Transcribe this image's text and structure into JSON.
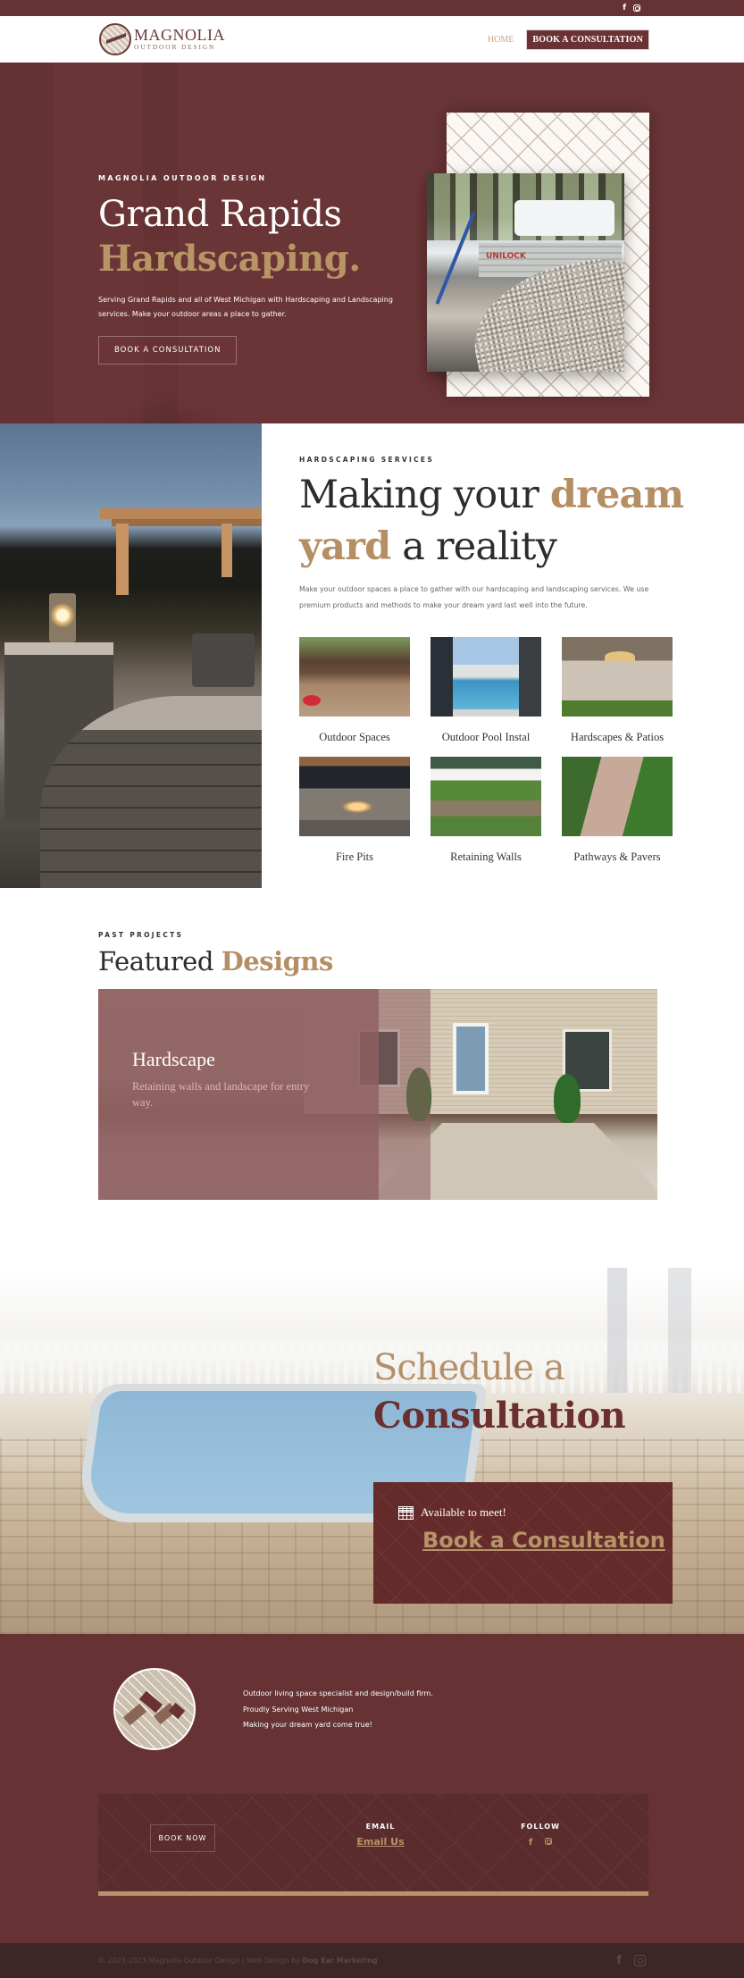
{
  "topbar": {
    "social": [
      {
        "icon": "facebook-icon",
        "glyph": "f"
      },
      {
        "icon": "instagram-icon"
      }
    ]
  },
  "header": {
    "logo": {
      "line1": "MAGNOLIA",
      "line2": "OUTDOOR DESIGN"
    },
    "nav": {
      "home": "HOME",
      "cta": "BOOK A CONSULTATION"
    }
  },
  "hero": {
    "eyebrow": "MAGNOLIA OUTDOOR DESIGN",
    "title_line1": "Grand Rapids",
    "title_line2": "Hardscaping.",
    "description": "Serving Grand Rapids and all of West Michigan with Hardscaping and Landscaping services. Make your outdoor areas a place to gather.",
    "button": "BOOK A CONSULTATION",
    "photo_sign": "UNILOCK"
  },
  "services": {
    "eyebrow": "HARDSCAPING SERVICES",
    "title_part1": "Making your ",
    "title_accent1": "dream yard",
    "title_part2": " a reality",
    "description": "Make your outdoor spaces a place to gather with our hardscaping and landscaping services. We use premium products and methods to make your dream yard last well into the future.",
    "items": [
      {
        "label": "Outdoor Spaces"
      },
      {
        "label": "Outdoor Pool Instal"
      },
      {
        "label": "Hardscapes & Patios"
      },
      {
        "label": "Fire Pits"
      },
      {
        "label": "Retaining Walls"
      },
      {
        "label": "Pathways & Pavers"
      }
    ]
  },
  "featured": {
    "eyebrow": "PAST PROJECTS",
    "title_plain": "Featured ",
    "title_accent": "Designs",
    "slide": {
      "heading": "Hardscape",
      "caption": "Retaining walls and landscape for entry way."
    }
  },
  "schedule": {
    "title_line1": "Schedule a",
    "title_line2": "Consultation",
    "available": "Available to meet!",
    "link": "Book a Consultation"
  },
  "footer": {
    "lines": [
      "Outdoor living space specialist and design/build firm.",
      "Proudly Serving West Michigan",
      "Making your dream yard come true!"
    ],
    "book_now": "BOOK NOW",
    "email_heading": "EMAIL",
    "email_link": "Email Us",
    "follow_heading": "FOLLOW",
    "copyright": "© 2021-2023 Magnolia Outdoor Design | Web Design by ",
    "credit": "Dog Ear Marketing"
  },
  "colors": {
    "maroon": "#663334",
    "gold": "#b8946a",
    "featured_overlay": "#8e5f61"
  }
}
